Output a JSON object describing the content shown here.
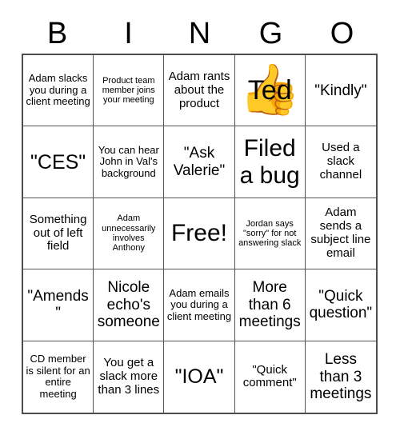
{
  "header": {
    "letters": [
      "B",
      "I",
      "N",
      "G",
      "O"
    ]
  },
  "grid": {
    "columns": 5,
    "rows": 5,
    "cells": [
      {
        "text": "Adam slacks you during a client meeting",
        "size": "s"
      },
      {
        "text": "Product team member joins your meeting",
        "size": "xs"
      },
      {
        "text": "Adam rants about the product",
        "size": "m"
      },
      {
        "text": "Ted",
        "size": "xl",
        "emoji": "👍",
        "emoji_name": "thumbs-up-emoji"
      },
      {
        "text": "\"Kindly\"",
        "size": "l"
      },
      {
        "text": "\"CES\"",
        "size": "xl"
      },
      {
        "text": "You can hear John in Val's background",
        "size": "s"
      },
      {
        "text": "\"Ask Valerie\"",
        "size": "l"
      },
      {
        "text": "Filed a bug",
        "size": "xxl"
      },
      {
        "text": "Used a slack channel",
        "size": "m"
      },
      {
        "text": "Something out of left field",
        "size": "m"
      },
      {
        "text": "Adam unnecessarily involves Anthony",
        "size": "xs"
      },
      {
        "text": "Free!",
        "size": "xxl"
      },
      {
        "text": "Jordan says \"sorry\" for not answering slack",
        "size": "xs"
      },
      {
        "text": "Adam sends a subject line email",
        "size": "m"
      },
      {
        "text": "\"Amends\"",
        "size": "l"
      },
      {
        "text": "Nicole echo's someone",
        "size": "l"
      },
      {
        "text": "Adam emails you during a client meeting",
        "size": "s"
      },
      {
        "text": "More than 6 meetings",
        "size": "l"
      },
      {
        "text": "\"Quick question\"",
        "size": "l"
      },
      {
        "text": "CD member is silent for an entire meeting",
        "size": "s"
      },
      {
        "text": "You get a slack more than 3 lines",
        "size": "m"
      },
      {
        "text": "\"IOA\"",
        "size": "xl"
      },
      {
        "text": "\"Quick comment\"",
        "size": "m"
      },
      {
        "text": "Less than 3 meetings",
        "size": "l"
      }
    ]
  },
  "colors": {
    "background": "#ffffff",
    "text": "#000000",
    "outer_border": "#4d4d4d",
    "inner_border": "#555555"
  }
}
